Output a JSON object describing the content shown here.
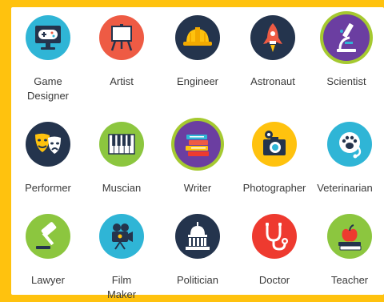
{
  "careers": [
    {
      "label": "Game\nDesigner",
      "icon": "gamepad-monitor-icon",
      "color": "#2fb5d6"
    },
    {
      "label": "Artist",
      "icon": "easel-icon",
      "color": "#ee5b44"
    },
    {
      "label": "Engineer",
      "icon": "hard-hat-icon",
      "color": "#24344d"
    },
    {
      "label": "Astronaut",
      "icon": "rocket-icon",
      "color": "#24344d"
    },
    {
      "label": "Scientist",
      "icon": "microscope-icon",
      "color": "#6b3ea1",
      "selected": true
    },
    {
      "label": "Performer",
      "icon": "theater-masks-icon",
      "color": "#24344d"
    },
    {
      "label": "Muscian",
      "icon": "piano-keys-icon",
      "color": "#8cc63f"
    },
    {
      "label": "Writer",
      "icon": "book-stack-icon",
      "color": "#6b3ea1",
      "selected": true
    },
    {
      "label": "Photographer",
      "icon": "camera-icon",
      "color": "#ffc20e"
    },
    {
      "label": "Veterinarian",
      "icon": "paw-stethoscope-icon",
      "color": "#2fb5d6"
    },
    {
      "label": "Lawyer",
      "icon": "gavel-icon",
      "color": "#8cc63f"
    },
    {
      "label": "Film\nMaker",
      "icon": "film-camera-icon",
      "color": "#2fb5d6"
    },
    {
      "label": "Politician",
      "icon": "capitol-icon",
      "color": "#24344d"
    },
    {
      "label": "Doctor",
      "icon": "stethoscope-icon",
      "color": "#ee3a2f"
    },
    {
      "label": "Teacher",
      "icon": "apple-books-icon",
      "color": "#8cc63f"
    }
  ],
  "accent": {
    "background": "#ffc20e",
    "selected_ring": "#a5c930"
  }
}
